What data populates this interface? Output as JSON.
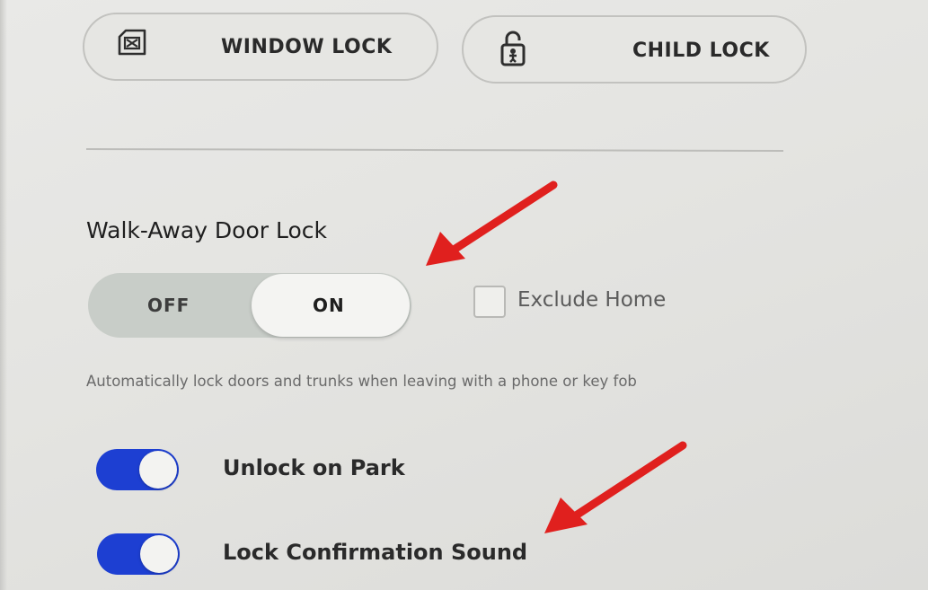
{
  "lock_buttons": {
    "window_lock": {
      "label": "WINDOW LOCK",
      "icon": "window-lock-icon"
    },
    "child_lock": {
      "label": "CHILD LOCK",
      "icon": "child-lock-icon"
    }
  },
  "walk_away": {
    "title": "Walk-Away Door Lock",
    "off_label": "OFF",
    "on_label": "ON",
    "selected": "ON",
    "exclude_home": {
      "label": "Exclude Home",
      "checked": false
    },
    "description": "Automatically lock doors and trunks when leaving with a phone or key fob"
  },
  "toggles": [
    {
      "label": "Unlock on Park",
      "enabled": true
    },
    {
      "label": "Lock Confirmation Sound",
      "enabled": true
    }
  ],
  "colors": {
    "toggle_on": "#1d3fd2",
    "annotation_arrow": "#e0201e",
    "background": "#e6e6e3"
  }
}
